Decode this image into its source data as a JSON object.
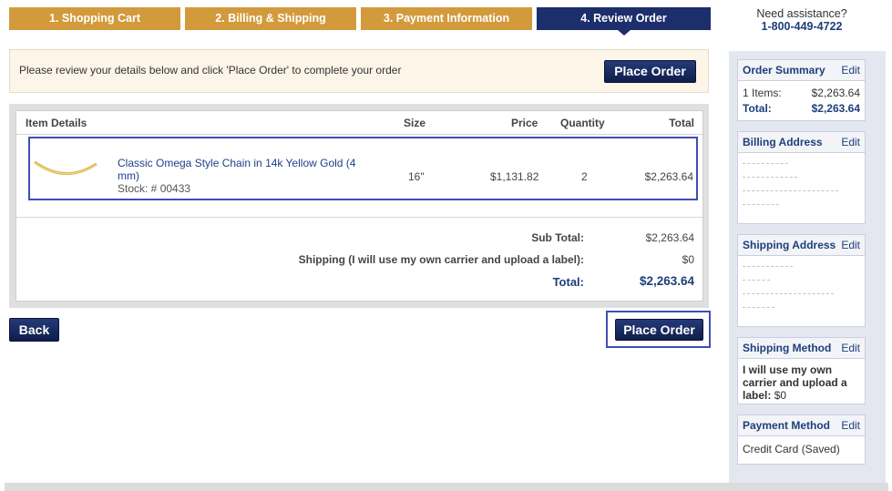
{
  "steps": [
    {
      "label": "1. Shopping Cart"
    },
    {
      "label": "2. Billing & Shipping"
    },
    {
      "label": "3. Payment Information"
    },
    {
      "label": "4. Review Order"
    }
  ],
  "assistance": {
    "label": "Need assistance?",
    "phone": "1-800-449-4722"
  },
  "notice": {
    "message": "Please review your details below and click 'Place Order' to complete your order",
    "place_order": "Place Order"
  },
  "table": {
    "headers": {
      "item": "Item Details",
      "size": "Size",
      "price": "Price",
      "quantity": "Quantity",
      "total": "Total"
    },
    "item": {
      "name": "Classic Omega Style Chain in 14k Yellow Gold (4 mm)",
      "stock": "Stock: # 00433",
      "size": "16\"",
      "price": "$1,131.82",
      "quantity": "2",
      "total": "$2,263.64"
    },
    "summary": {
      "subtotal_label": "Sub Total:",
      "subtotal": "$2,263.64",
      "shipping_label": "Shipping (I will use my own carrier and upload a label):",
      "shipping": "$0",
      "total_label": "Total:",
      "total": "$2,263.64"
    }
  },
  "buttons": {
    "back": "Back",
    "place_order": "Place Order"
  },
  "sidebar": {
    "edit": "Edit",
    "order_summary": {
      "title": "Order Summary",
      "items_label": "1 Items:",
      "items_value": "$2,263.64",
      "total_label": "Total:",
      "total_value": "$2,263.64"
    },
    "billing": {
      "title": "Billing Address"
    },
    "shipping": {
      "title": "Shipping Address"
    },
    "method": {
      "title": "Shipping Method",
      "text": "I will use my own carrier and upload a label:",
      "value": "$0"
    },
    "payment": {
      "title": "Payment Method",
      "text": "Credit Card (Saved)"
    }
  },
  "colors": {
    "step_done": "#d39a3c",
    "step_active": "#1c2e6b",
    "accent": "#1c3f7a",
    "highlight": "#3d4fb5"
  }
}
